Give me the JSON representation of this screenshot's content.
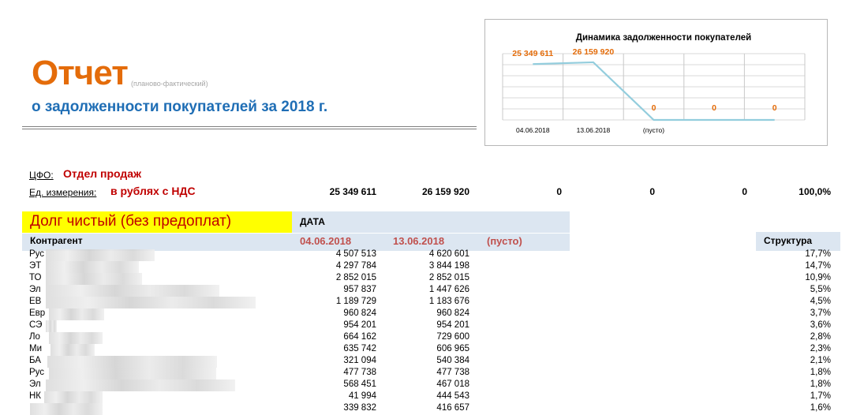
{
  "report": {
    "title": "Отчет",
    "title_note": "(планово-фактический)",
    "subtitle": "о задолженности покупателей за 2018 г.",
    "cfo_label": "ЦФО:",
    "cfo_value": "Отдел продаж",
    "unit_label": "Ед. измерения:",
    "unit_value": "в рублях с НДС"
  },
  "totals": [
    "25 349 611",
    "26 159 920",
    "0",
    "0",
    "0",
    "100,0%"
  ],
  "table": {
    "section_title": "Долг чистый (без предоплат)",
    "date_header": "ДАТА",
    "counterparty_header": "Контрагент",
    "date_cols": [
      "04.06.2018",
      "13.06.2018",
      "(пусто)"
    ],
    "structure_header": "Структура",
    "rows": [
      {
        "name": "Рус",
        "v1": "4 507 513",
        "v2": "4 620 601",
        "pct": "17,7%"
      },
      {
        "name": "ЭТ",
        "v1": "4 297 784",
        "v2": "3 844 198",
        "pct": "14,7%"
      },
      {
        "name": "ТО",
        "v1": "2 852 015",
        "v2": "2 852 015",
        "pct": "10,9%"
      },
      {
        "name": "Эл",
        "v1": "957 837",
        "v2": "1 447 626",
        "pct": "5,5%"
      },
      {
        "name": "ЕВ",
        "v1": "1 189 729",
        "v2": "1 183 676",
        "pct": "4,5%"
      },
      {
        "name": "Евр",
        "v1": "960 824",
        "v2": "960 824",
        "pct": "3,7%"
      },
      {
        "name": "СЭ",
        "v1": "954 201",
        "v2": "954 201",
        "pct": "3,6%"
      },
      {
        "name": "Ло",
        "v1": "664 162",
        "v2": "729 600",
        "pct": "2,8%"
      },
      {
        "name": "Ми",
        "v1": "635 742",
        "v2": "606 965",
        "pct": "2,3%"
      },
      {
        "name": "БА",
        "v1": "321 094",
        "v2": "540 384",
        "pct": "2,1%"
      },
      {
        "name": "Рус",
        "v1": "477 738",
        "v2": "477 738",
        "pct": "1,8%"
      },
      {
        "name": "Эл",
        "v1": "568 451",
        "v2": "467 018",
        "pct": "1,8%"
      },
      {
        "name": "НК",
        "v1": "41 994",
        "v2": "444 543",
        "pct": "1,7%"
      },
      {
        "name": "",
        "v1": "339 832",
        "v2": "416 657",
        "pct": "1,6%"
      }
    ]
  },
  "chart_data": {
    "type": "line",
    "title": "Динамика задолженности покупателей",
    "categories": [
      "04.06.2018",
      "13.06.2018",
      "(пусто)",
      "",
      ""
    ],
    "values": [
      25349611,
      26159920,
      0,
      0,
      0
    ],
    "data_labels": [
      "25 349 611",
      "26 159 920",
      "0",
      "0",
      "0"
    ],
    "grid": true,
    "line_color": "#93cddd",
    "label_color": "#e46c0a"
  }
}
